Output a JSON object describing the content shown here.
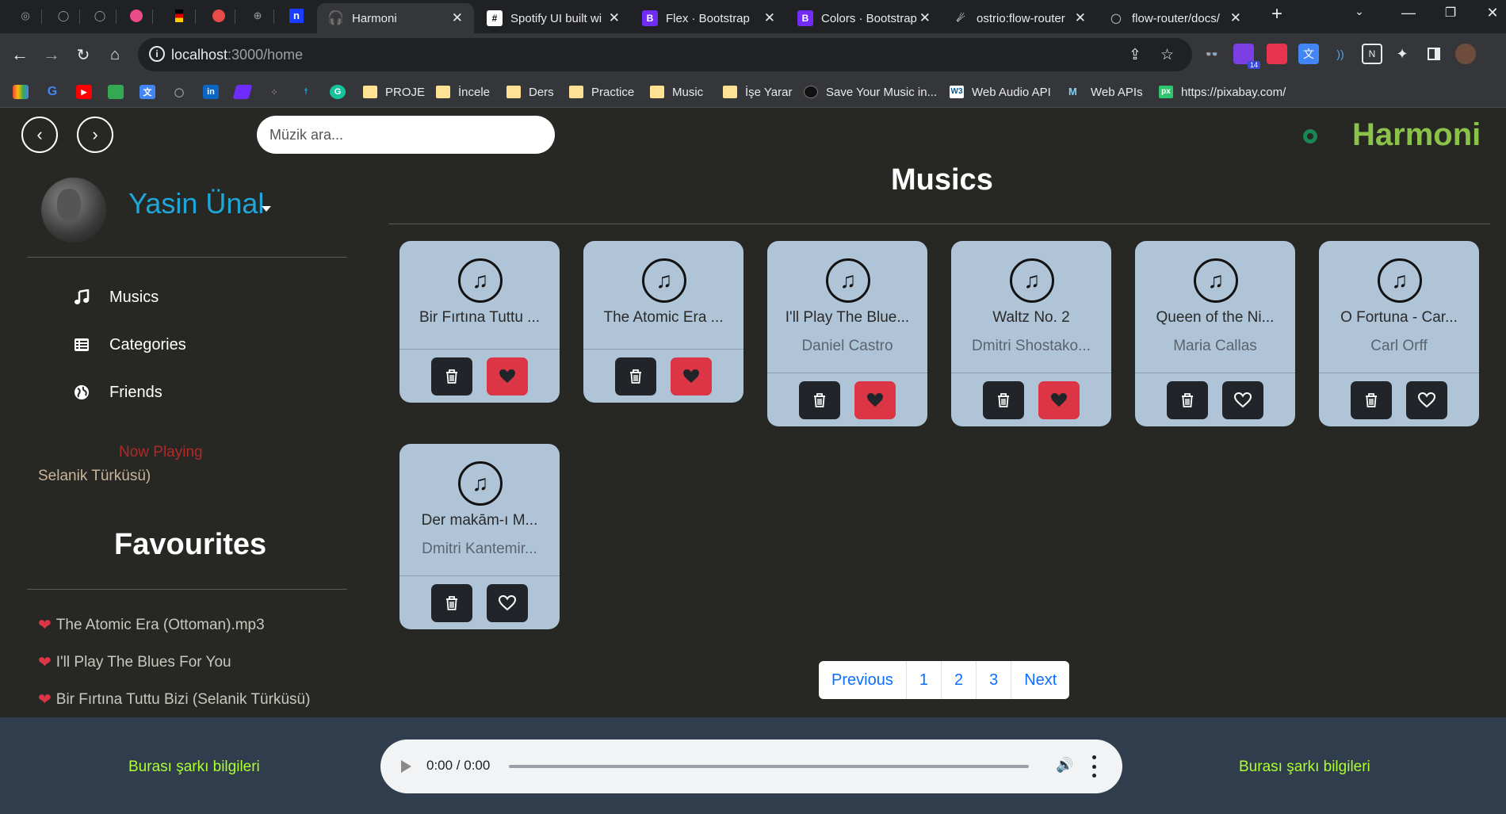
{
  "browser": {
    "tabs": [
      {
        "label": "Harmoni",
        "icon": "headphones-icon",
        "active": true
      },
      {
        "label": "Spotify UI built wi",
        "icon": "codepen-icon"
      },
      {
        "label": "Flex · Bootstrap",
        "icon": "bootstrap-icon"
      },
      {
        "label": "Colors · Bootstrap",
        "icon": "bootstrap-icon"
      },
      {
        "label": "ostrio:flow-router",
        "icon": "meteor-icon"
      },
      {
        "label": "flow-router/docs/",
        "icon": "github-icon"
      }
    ],
    "new_tab_label": "+",
    "address": {
      "host": "localhost",
      "path": ":3000/home"
    },
    "bookmarks": [
      {
        "label": "PROJE"
      },
      {
        "label": "İncele"
      },
      {
        "label": "Ders"
      },
      {
        "label": "Practice"
      },
      {
        "label": "Music"
      },
      {
        "label": "İşe Yarar"
      },
      {
        "label": "Save Your Music in..."
      },
      {
        "label": "Web Audio API"
      },
      {
        "label": "Web APIs"
      },
      {
        "label": "https://pixabay.com/"
      }
    ],
    "extension_badge": "14"
  },
  "app": {
    "brand": "Harmoni",
    "search": {
      "placeholder": "Müzik ara...",
      "value": ""
    },
    "user": {
      "name": "Yasin Ünal"
    },
    "nav": [
      {
        "label": "Musics",
        "icon": "music-note-icon"
      },
      {
        "label": "Categories",
        "icon": "table-list-icon"
      },
      {
        "label": "Friends",
        "icon": "globe-icon"
      }
    ],
    "now_playing": {
      "label": "Now Playing",
      "song": "Selanik Türküsü)"
    },
    "favourites": {
      "title": "Favourites",
      "items": [
        "The Atomic Era (Ottoman).mp3",
        "I'll Play The Blues For You",
        "Bir Fırtına Tuttu Bizi (Selanik Türküsü)"
      ]
    },
    "musics": {
      "title": "Musics",
      "cards": [
        {
          "title": "Bir Fırtına Tuttu ...",
          "artist": "",
          "favourite": true
        },
        {
          "title": "The Atomic Era ...",
          "artist": "",
          "favourite": true
        },
        {
          "title": "I'll Play The Blue...",
          "artist": "Daniel Castro",
          "favourite": true
        },
        {
          "title": "Waltz No. 2",
          "artist": "Dmitri Shostako...",
          "favourite": true
        },
        {
          "title": "Queen of the Ni...",
          "artist": "Maria Callas",
          "favourite": false
        },
        {
          "title": "O Fortuna - Car...",
          "artist": "Carl Orff",
          "favourite": false
        },
        {
          "title": "Der makām-ı M...",
          "artist": "Dmitri Kantemir...",
          "favourite": false
        }
      ]
    },
    "pagination": [
      "Previous",
      "1",
      "2",
      "3",
      "Next"
    ],
    "player": {
      "left_info": "Burası şarkı bilgileri",
      "right_info": "Burası şarkı bilgileri",
      "time": "0:00 / 0:00"
    },
    "colors": {
      "brand": "#8bc34a",
      "username": "#1ea7d9",
      "card": "#b0c4d8",
      "favourite": "#dc3545",
      "song_info": "#adff2f",
      "player_bg": "#2f3d4d"
    }
  }
}
